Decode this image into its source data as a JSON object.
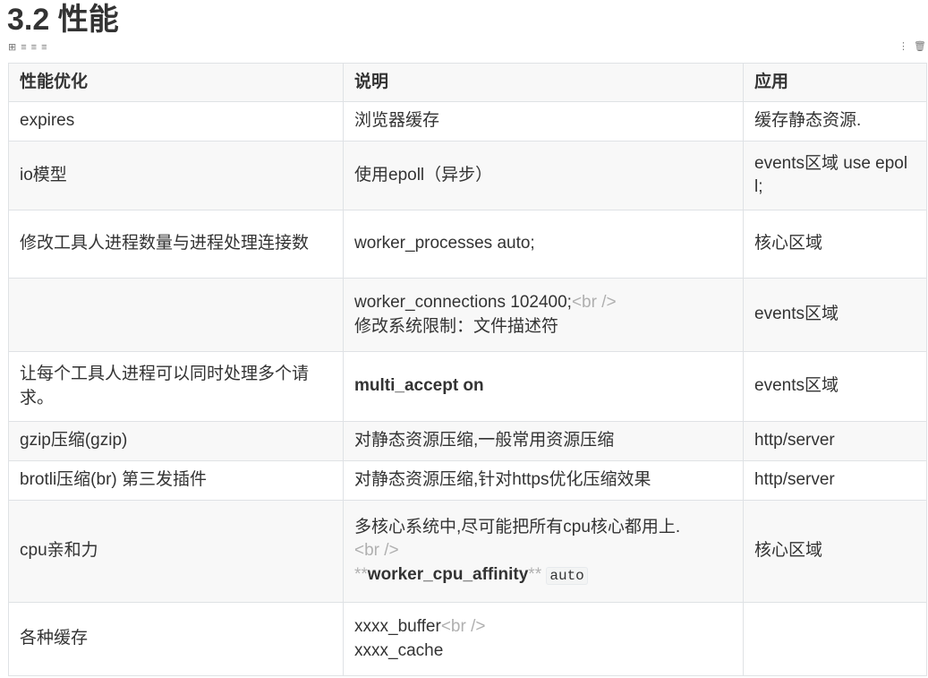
{
  "heading": "3.2 性能",
  "toolbar": {
    "left_icons": [
      "grid-icon",
      "align-left-icon",
      "align-center-icon",
      "align-right-icon"
    ],
    "right_icons": [
      "more-vertical-icon",
      "trash-icon"
    ]
  },
  "table": {
    "headers": [
      "性能优化",
      "说明",
      "应用"
    ],
    "rows": [
      {
        "c0": "expires",
        "c1": "浏览器缓存",
        "c2": "缓存静态资源."
      },
      {
        "c0": "io模型",
        "c1": "使用epoll（异步）",
        "c2": "events区域 use epoll;"
      },
      {
        "c0": "修改工具人进程数量与进程处理连接数",
        "c1": "worker_processes  auto;",
        "c2": "核心区域"
      },
      {
        "c0": "",
        "c1a": "worker_connections  102400;",
        "c1raw": "<br />",
        "c1b": "修改系统限制：文件描述符",
        "c2": "events区域"
      },
      {
        "c0": "让每个工具人进程可以同时处理多个请求。",
        "c1": "multi_accept on",
        "c2": "events区域"
      },
      {
        "c0": "gzip压缩(gzip)",
        "c1": "对静态资源压缩,一般常用资源压缩",
        "c2": "http/server"
      },
      {
        "c0": "brotli压缩(br) 第三发插件",
        "c1": "对静态资源压缩,针对https优化压缩效果",
        "c2": "http/server"
      },
      {
        "c0": "cpu亲和力",
        "c1a": "多核心系统中,尽可能把所有cpu核心都用上.",
        "c1raw": "<br />",
        "c1stars": "**",
        "c1bold": "worker_cpu_affinity",
        "c1code": "auto",
        "c2": "核心区域"
      },
      {
        "c0": "各种缓存",
        "c1a": "xxxx_buffer",
        "c1raw": "<br />",
        "c1b": "xxxx_cache",
        "c2": ""
      }
    ]
  }
}
